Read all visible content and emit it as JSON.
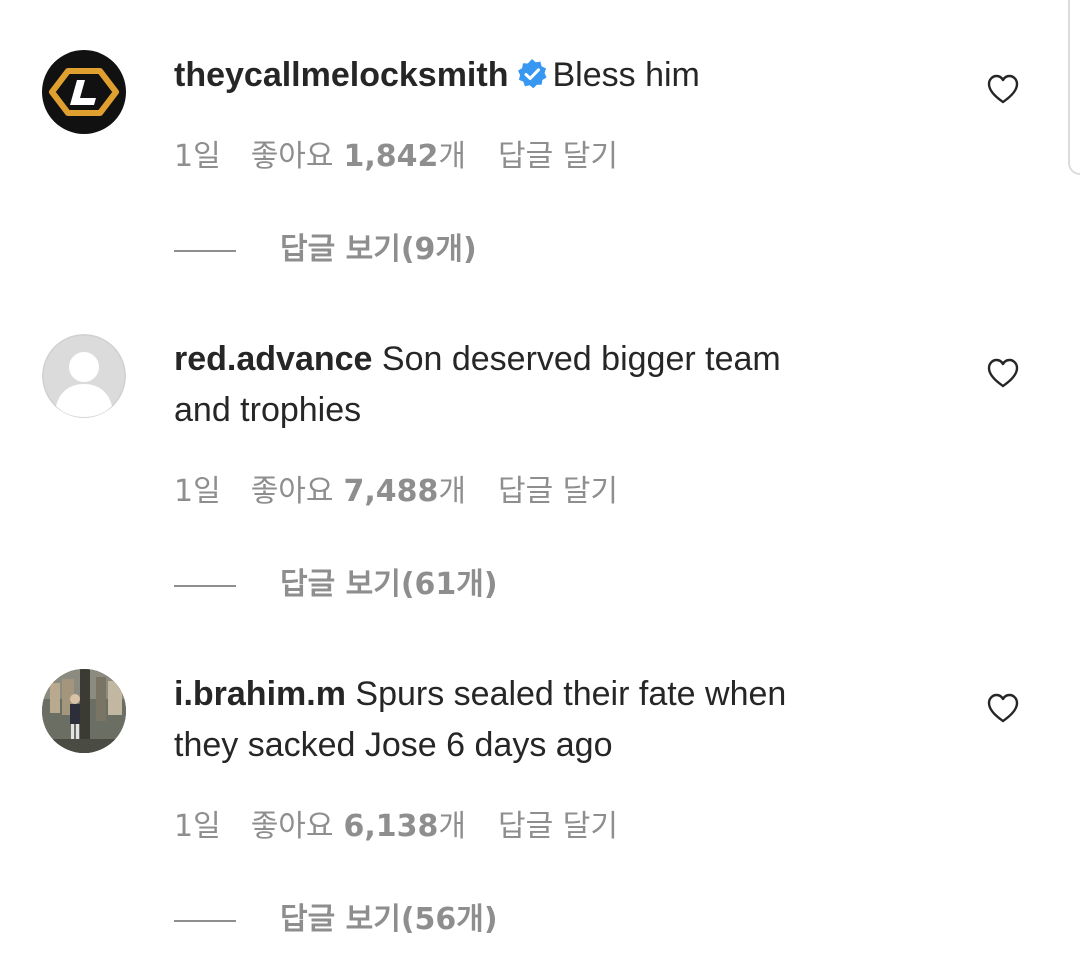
{
  "comments": [
    {
      "avatar": "locksmith-hexagon-logo",
      "username": "theycallmelocksmith",
      "verified": true,
      "text_line1": "Bless him",
      "text_line2": "",
      "time": "1일",
      "likes_prefix": "좋아요",
      "likes_count": "1,842",
      "likes_unit": "개",
      "reply_action": "답글 달기",
      "view_replies": "답글 보기(9개)"
    },
    {
      "avatar": "default-profile-silhouette",
      "username": "red.advance",
      "verified": false,
      "text_line1": "Son deserved bigger team",
      "text_line2": "and trophies",
      "time": "1일",
      "likes_prefix": "좋아요",
      "likes_count": "7,488",
      "likes_unit": "개",
      "reply_action": "답글 달기",
      "view_replies": "답글 보기(61개)"
    },
    {
      "avatar": "user-photo",
      "username": "i.brahim.m",
      "verified": false,
      "text_line1": "Spurs sealed their fate when",
      "text_line2": "they sacked Jose 6 days ago",
      "time": "1일",
      "likes_prefix": "좋아요",
      "likes_count": "6,138",
      "likes_unit": "개",
      "reply_action": "답글 달기",
      "view_replies": "답글 보기(56개)"
    }
  ],
  "colors": {
    "text": "#262626",
    "secondary": "#8e8e8e",
    "verified_badge": "#3897f0",
    "brand_logo": "#e0a030"
  },
  "icons": {
    "like": "heart-outline-icon",
    "verified": "verified-badge-icon"
  }
}
